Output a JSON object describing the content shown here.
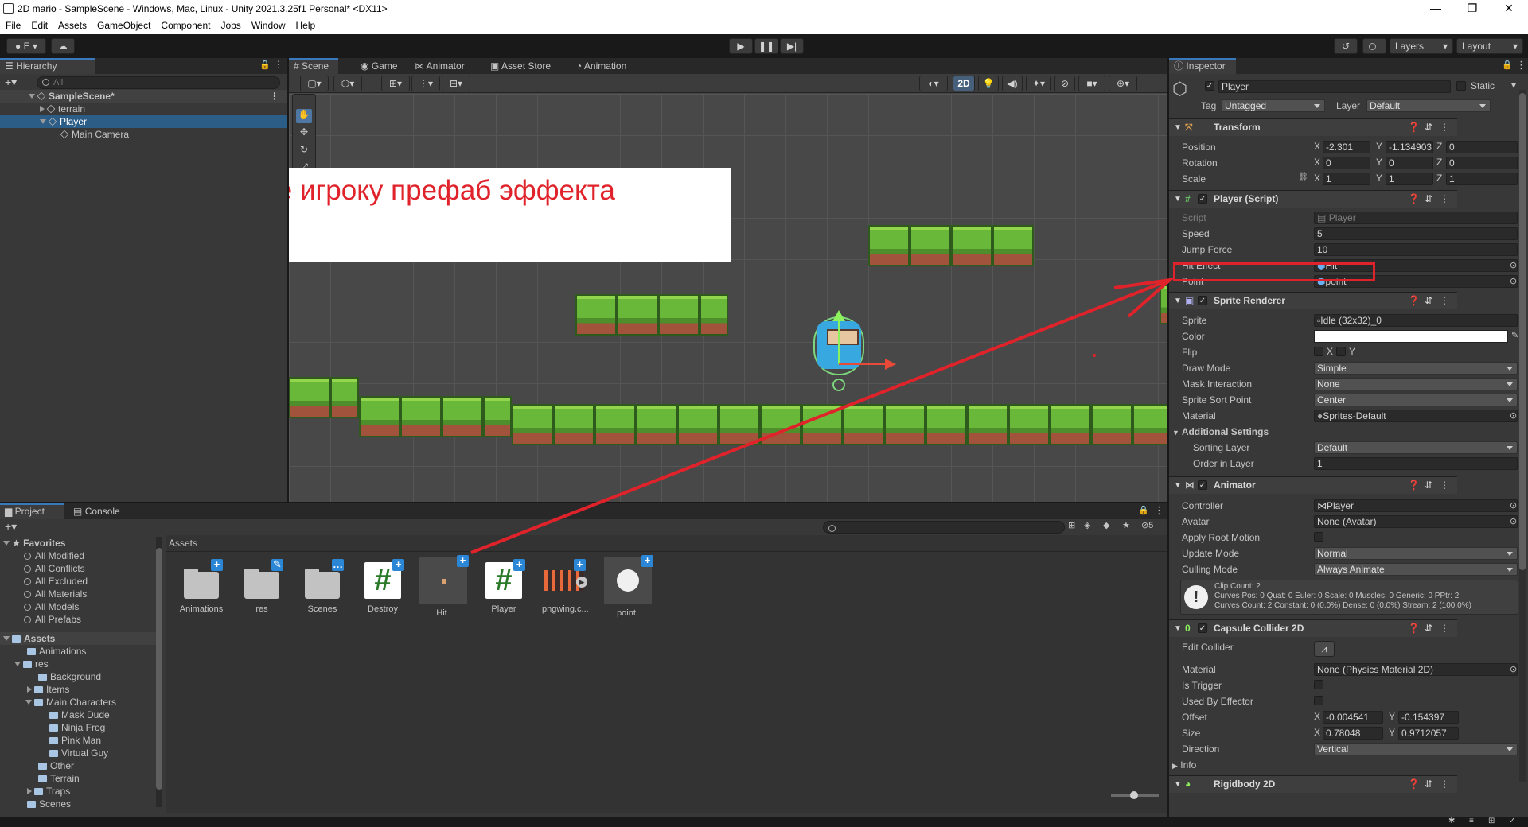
{
  "window": {
    "title": "2D mario - SampleScene - Windows, Mac, Linux - Unity 2021.3.25f1 Personal* <DX11>",
    "minimize": "—",
    "maximize": "❐",
    "close": "✕"
  },
  "menu": [
    "File",
    "Edit",
    "Assets",
    "GameObject",
    "Component",
    "Jobs",
    "Window",
    "Help"
  ],
  "toolbar": {
    "account_label": "E",
    "layers_label": "Layers",
    "layout_label": "Layout"
  },
  "hierarchy": {
    "tab": "Hierarchy",
    "search_placeholder": "All",
    "items": [
      {
        "label": "SampleScene*"
      },
      {
        "label": "terrain"
      },
      {
        "label": "Player"
      },
      {
        "label": "Main Camera"
      }
    ]
  },
  "scene_tabs": [
    "Scene",
    "Game",
    "Animator",
    "Asset Store",
    "Animation"
  ],
  "scene": {
    "mode_2d": "2D",
    "annotation_text": "Назначьте игроку префаб эффекта касания."
  },
  "project": {
    "tabs": [
      "Project",
      "Console"
    ],
    "hidden_count": "5",
    "favorites_label": "Favorites",
    "favorites": [
      "All Modified",
      "All Conflicts",
      "All Excluded",
      "All Materials",
      "All Models",
      "All Prefabs"
    ],
    "assets_label": "Assets",
    "tree": [
      "Animations",
      "res",
      "Background",
      "Items",
      "Main Characters",
      "Mask Dude",
      "Ninja Frog",
      "Pink Man",
      "Virtual Guy",
      "Other",
      "Terrain",
      "Traps",
      "Scenes"
    ],
    "breadcrumb": "Assets",
    "assets": [
      "Animations",
      "res",
      "Scenes",
      "Destroy",
      "Hit",
      "Player",
      "pngwing.c...",
      "point"
    ]
  },
  "inspector": {
    "tab": "Inspector",
    "object_name": "Player",
    "static_label": "Static",
    "tag_label": "Tag",
    "tag_value": "Untagged",
    "layer_label": "Layer",
    "layer_value": "Default",
    "transform": {
      "title": "Transform",
      "position_label": "Position",
      "pos_x": "-2.301",
      "pos_y": "-1.134903",
      "pos_z": "0",
      "rotation_label": "Rotation",
      "rot_x": "0",
      "rot_y": "0",
      "rot_z": "0",
      "scale_label": "Scale",
      "scale_x": "1",
      "scale_y": "1",
      "scale_z": "1"
    },
    "player_script": {
      "title": "Player (Script)",
      "script_label": "Script",
      "script_value": "Player",
      "speed_label": "Speed",
      "speed_value": "5",
      "jump_label": "Jump Force",
      "jump_value": "10",
      "hit_label": "Hit Effect",
      "hit_value": "Hit",
      "point_label": "Point",
      "point_value": "point"
    },
    "sprite_renderer": {
      "title": "Sprite Renderer",
      "sprite_label": "Sprite",
      "sprite_value": "Idle (32x32)_0",
      "color_label": "Color",
      "flip_label": "Flip",
      "flip_x": "X",
      "flip_y": "Y",
      "draw_label": "Draw Mode",
      "draw_value": "Simple",
      "mask_label": "Mask Interaction",
      "mask_value": "None",
      "sort_point_label": "Sprite Sort Point",
      "sort_point_value": "Center",
      "material_label": "Material",
      "material_value": "Sprites-Default",
      "additional_label": "Additional Settings",
      "sorting_layer_label": "Sorting Layer",
      "sorting_layer_value": "Default",
      "order_label": "Order in Layer",
      "order_value": "1"
    },
    "animator": {
      "title": "Animator",
      "controller_label": "Controller",
      "controller_value": "Player",
      "avatar_label": "Avatar",
      "avatar_value": "None (Avatar)",
      "root_motion_label": "Apply Root Motion",
      "update_label": "Update Mode",
      "update_value": "Normal",
      "culling_label": "Culling Mode",
      "culling_value": "Always Animate",
      "info_line1": "Clip Count: 2",
      "info_line2": "Curves Pos: 0 Quat: 0 Euler: 0 Scale: 0 Muscles: 0 Generic: 0 PPtr: 2",
      "info_line3": "Curves Count: 2 Constant: 0 (0.0%) Dense: 0 (0.0%) Stream: 2 (100.0%)"
    },
    "capsule": {
      "title": "Capsule Collider 2D",
      "edit_label": "Edit Collider",
      "material_label": "Material",
      "material_value": "None (Physics Material 2D)",
      "trigger_label": "Is Trigger",
      "effector_label": "Used By Effector",
      "offset_label": "Offset",
      "offset_x": "-0.004541",
      "offset_y": "-0.154397",
      "size_label": "Size",
      "size_x": "0.78048",
      "size_y": "0.9712057",
      "direction_label": "Direction",
      "direction_value": "Vertical",
      "info_label": "Info"
    },
    "rigidbody_title": "Rigidbody 2D"
  },
  "colors": {
    "accent": "#3a79bb",
    "annotation": "#e0232b",
    "selection": "#2c5d87"
  }
}
